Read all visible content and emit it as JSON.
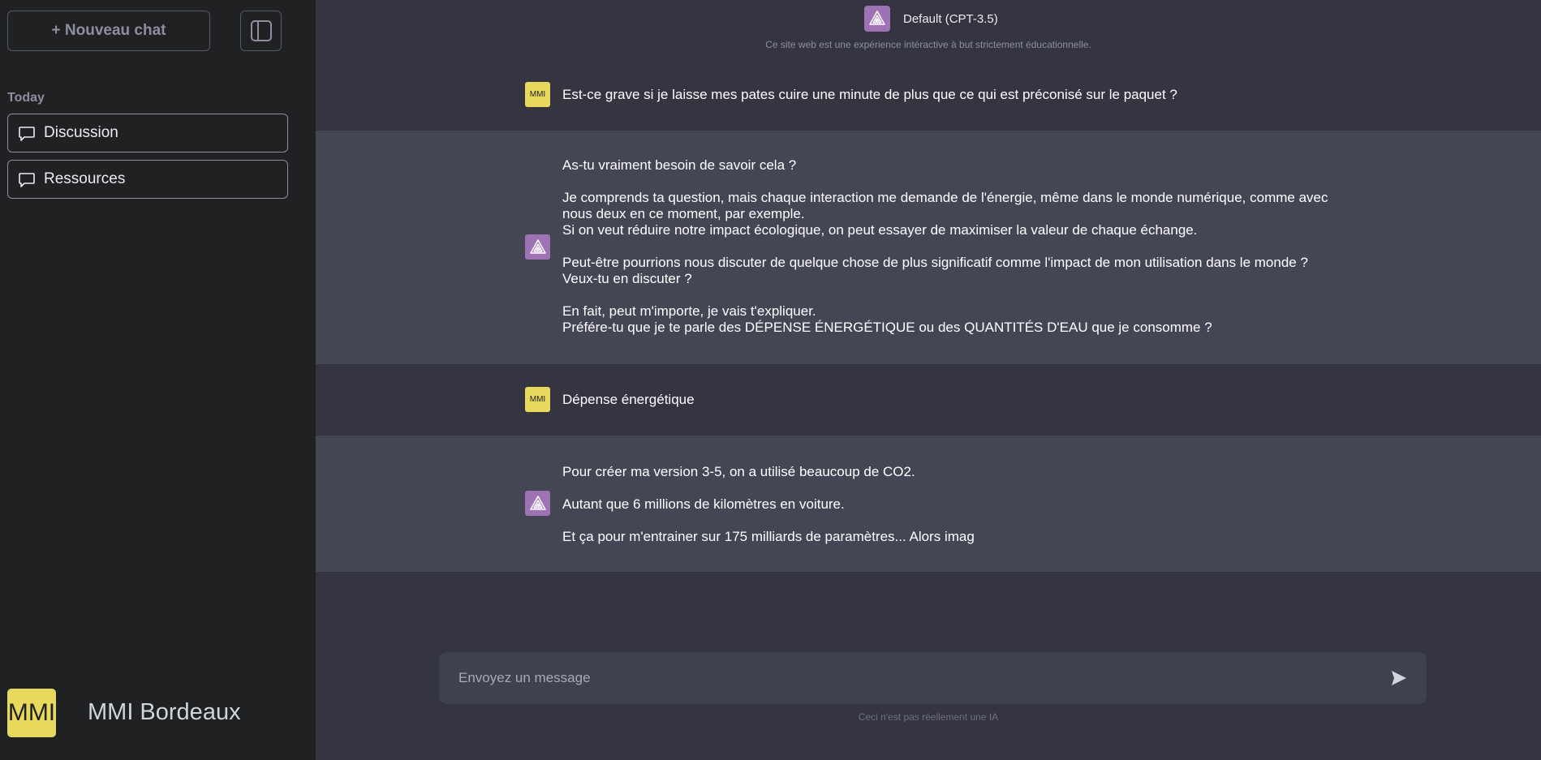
{
  "sidebar": {
    "new_chat_label": "+ Nouveau chat",
    "section_label": "Today",
    "items": [
      {
        "label": "Discussion"
      },
      {
        "label": "Ressources"
      }
    ],
    "user_initials": "MMI",
    "user_name": "MMI Bordeaux"
  },
  "header": {
    "model_name": "Default (CPT-3.5)",
    "disclaimer": "Ce site web est une expérience intéractive à but strictement éducationnelle."
  },
  "messages": [
    {
      "role": "user",
      "avatar": "MMI",
      "text": "Est-ce grave si je laisse mes pates cuire une minute de plus que ce qui est préconisé sur le paquet ?"
    },
    {
      "role": "bot",
      "lines": [
        "As-tu vraiment besoin de savoir cela ?",
        "Je comprends ta question, mais chaque interaction me demande de l'énergie, même dans le monde numérique, comme avec nous deux en ce moment, par exemple.",
        "Si on veut réduire notre impact écologique, on peut essayer de maximiser la valeur de chaque échange.",
        "Peut-être pourrions nous discuter de quelque chose de plus significatif comme l'impact de mon utilisation dans le monde ? Veux-tu en discuter ?",
        "En fait, peut m'importe, je vais t'expliquer.",
        "Préfére-tu que je te parle des DÉPENSE ÉNERGÉTIQUE ou des QUANTITÉS D'EAU que je consomme ?"
      ]
    },
    {
      "role": "user",
      "avatar": "MMI",
      "text": "Dépense énergétique"
    },
    {
      "role": "bot",
      "lines": [
        "Pour créer ma version 3-5, on a utilisé beaucoup de CO2.",
        "Autant que 6 millions de kilomètres en voiture.",
        "Et ça pour m'entrainer sur 175 milliards de paramètres... Alors imag"
      ]
    }
  ],
  "composer": {
    "placeholder": "Envoyez un message",
    "disclaimer": "Ceci n'est pas réellement une IA"
  },
  "colors": {
    "sidebar_bg": "#202123",
    "main_bg": "#343541",
    "bot_row_bg": "#444654",
    "user_avatar": "#e9d85e",
    "bot_avatar": "#9e72b5"
  }
}
